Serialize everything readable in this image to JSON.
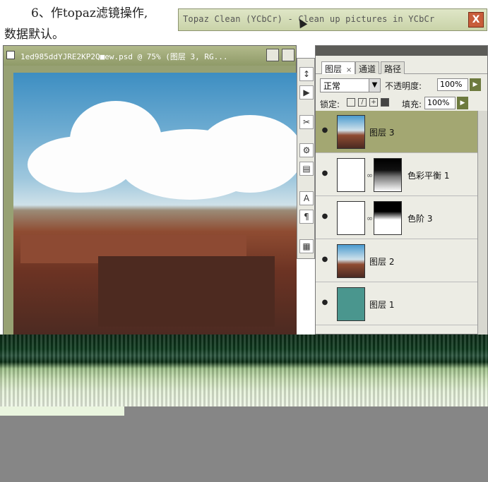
{
  "tutorial": {
    "line1": "6、作topaz滤镜操作,",
    "line2": "数据默认。"
  },
  "filter_window": {
    "title": "Topaz Clean (YCbCr) - Clean up pictures in YCbCr",
    "close_label": "X"
  },
  "document": {
    "title": "1ed985ddYJRE2KP2Q■ew.psd @ 75% (图层 3, RG..."
  },
  "tools": [
    "↕",
    "▶",
    "✂",
    "⚙",
    "▤",
    "A",
    "¶",
    "▦"
  ],
  "layers_panel": {
    "tabs": [
      {
        "label": "图层",
        "close": "×"
      },
      {
        "label": "通道"
      },
      {
        "label": "路径"
      }
    ],
    "blend_mode": "正常",
    "opacity_label": "不透明度:",
    "opacity_value": "100%",
    "lock_label": "锁定:",
    "fill_label": "填充:",
    "fill_value": "100%",
    "layers": [
      {
        "name": "图层 3",
        "thumb": "photo",
        "selected": true
      },
      {
        "name": "色彩平衡 1",
        "thumb": "adjustment-balance",
        "mask": "mask1"
      },
      {
        "name": "色阶 3",
        "thumb": "adjustment-levels",
        "mask": "mask2"
      },
      {
        "name": "图层 2",
        "thumb": "photo"
      },
      {
        "name": "图层 1",
        "thumb": "teal"
      }
    ]
  }
}
